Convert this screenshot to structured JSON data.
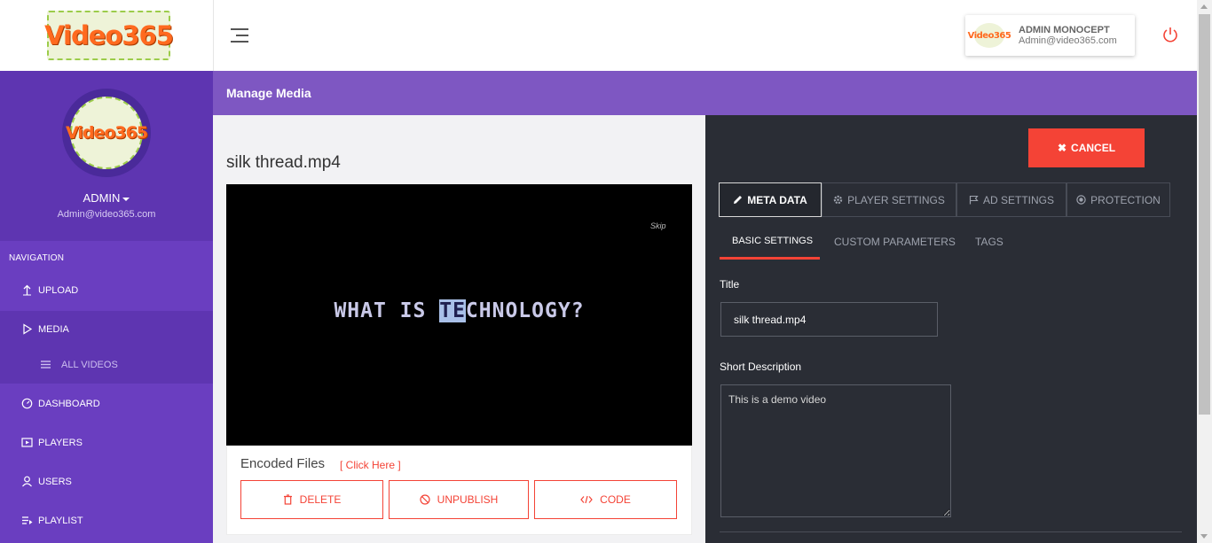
{
  "brand": {
    "logo_text": "Video365"
  },
  "topbar": {
    "user_name": "ADMIN MONOCEPT",
    "user_email": "Admin@video365.com"
  },
  "sidebar": {
    "profile_name": "ADMIN",
    "profile_email": "Admin@video365.com",
    "nav_heading": "NAVIGATION",
    "items": [
      {
        "label": "UPLOAD",
        "icon": "upload-icon"
      },
      {
        "label": "MEDIA",
        "icon": "play-icon"
      },
      {
        "label": "ALL VIDEOS",
        "icon": "list-icon"
      },
      {
        "label": "DASHBOARD",
        "icon": "dashboard-icon"
      },
      {
        "label": "PLAYERS",
        "icon": "player-icon"
      },
      {
        "label": "USERS",
        "icon": "user-icon"
      },
      {
        "label": "PLAYLIST",
        "icon": "playlist-icon"
      }
    ]
  },
  "header": {
    "title": "Manage Media"
  },
  "media": {
    "title": "silk thread.mp4",
    "player": {
      "skip_label": "Skip",
      "caption_pre": "WHAT IS ",
      "caption_hl": "TE",
      "caption_post": "CHNOLOGY?"
    },
    "encoded_files_label": "Encoded Files",
    "click_here_label": "[ Click Here ]",
    "actions": {
      "delete": "DELETE",
      "unpublish": "UNPUBLISH",
      "code": "CODE"
    }
  },
  "panel": {
    "cancel_label": "CANCEL",
    "tabs": [
      {
        "label": "META DATA",
        "icon": "pencil-icon"
      },
      {
        "label": "PLAYER SETTINGS",
        "icon": "gear-icon"
      },
      {
        "label": "AD SETTINGS",
        "icon": "flag-icon"
      },
      {
        "label": "PROTECTION",
        "icon": "shield-icon"
      }
    ],
    "subtabs": [
      "BASIC SETTINGS",
      "CUSTOM PARAMETERS",
      "TAGS"
    ],
    "form": {
      "title_label": "Title",
      "title_value": "silk thread.mp4",
      "desc_label": "Short Description",
      "desc_value": "This is a demo video"
    }
  },
  "colors": {
    "sidebar": "#6a3ec0",
    "header": "#7e57c2",
    "panel": "#2a2d35",
    "accent": "#f44336"
  }
}
